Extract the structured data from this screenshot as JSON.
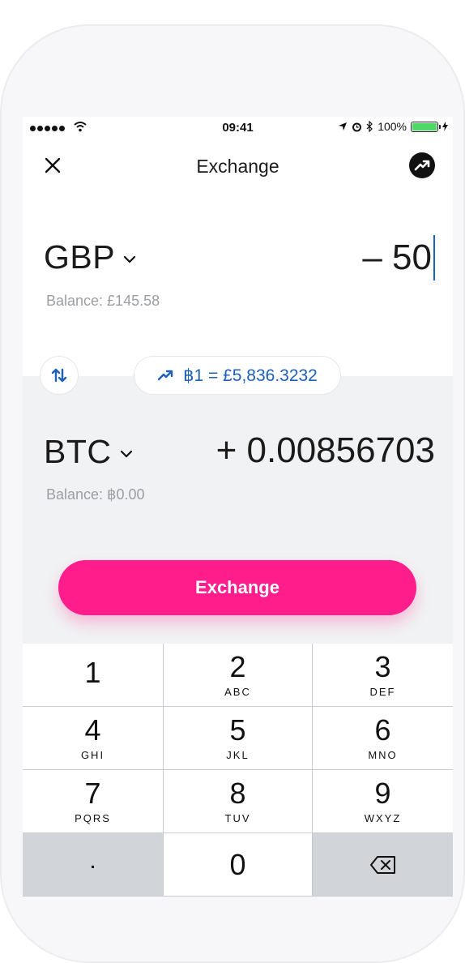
{
  "status_bar": {
    "time": "09:41",
    "battery": "100%",
    "battery_level": 1.0
  },
  "nav": {
    "title": "Exchange"
  },
  "from": {
    "currency": "GBP",
    "amount": "– 50",
    "balance": "Balance: £145.58"
  },
  "rate": {
    "text": "฿1 = £5,836.3232"
  },
  "to": {
    "currency": "BTC",
    "amount": "+ 0.00856703",
    "balance": "Balance: ฿0.00"
  },
  "exchange_button": {
    "label": "Exchange"
  },
  "keypad": {
    "keys": [
      {
        "digit": "1",
        "letters": ""
      },
      {
        "digit": "2",
        "letters": "ABC"
      },
      {
        "digit": "3",
        "letters": "DEF"
      },
      {
        "digit": "4",
        "letters": "GHI"
      },
      {
        "digit": "5",
        "letters": "JKL"
      },
      {
        "digit": "6",
        "letters": "MNO"
      },
      {
        "digit": "7",
        "letters": "PQRS"
      },
      {
        "digit": "8",
        "letters": "TUV"
      },
      {
        "digit": "9",
        "letters": "WXYZ"
      },
      {
        "digit": ".",
        "letters": ""
      },
      {
        "digit": "0",
        "letters": ""
      }
    ]
  },
  "colors": {
    "accent": "#ff1d8c",
    "rate_text": "#1e5fb8",
    "caret": "#1565c0"
  },
  "icons": [
    "close-icon",
    "trend-icon",
    "swap-icon",
    "chart-up-icon",
    "chevron-down-icon",
    "backspace-icon"
  ]
}
